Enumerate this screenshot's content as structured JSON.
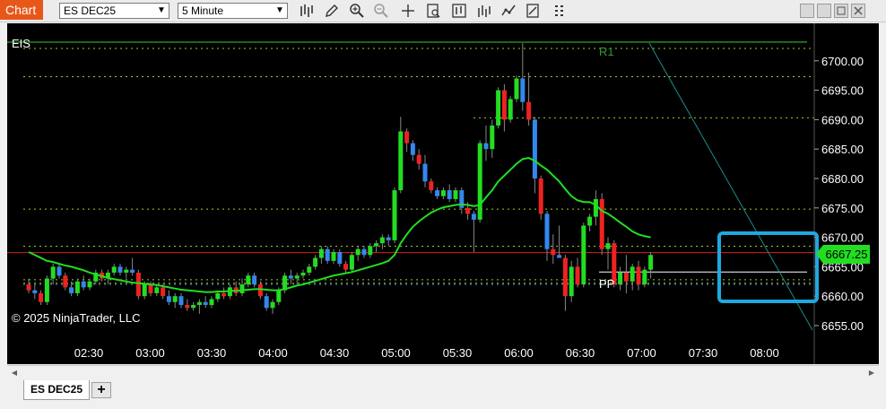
{
  "toolbar": {
    "chart_label": "Chart",
    "instrument": "ES DEC25",
    "interval": "5 Minute"
  },
  "chart": {
    "indicator_label": "EIS",
    "copyright": "© 2025 NinjaTrader, LLC",
    "r1_label": "R1",
    "pp_label": "PP",
    "price_tag": "6667.25"
  },
  "tabs": {
    "active": "ES DEC25",
    "add": "+"
  },
  "chart_data": {
    "type": "candlestick",
    "instrument": "ES DEC25",
    "x_ticks": [
      "02:30",
      "03:00",
      "03:30",
      "04:00",
      "04:30",
      "05:00",
      "05:30",
      "06:00",
      "06:30",
      "07:00",
      "07:30",
      "08:00"
    ],
    "y_ticks": [
      6655.0,
      6660.0,
      6665.0,
      6670.0,
      6675.0,
      6680.0,
      6685.0,
      6690.0,
      6695.0,
      6700.0
    ],
    "ylim": [
      6652.5,
      6703.5
    ],
    "last_price": 6667.25,
    "levels": {
      "r1": 6703.2,
      "pp": 6664.1,
      "red_line": 6667.4
    },
    "series": [
      {
        "name": "candles",
        "ohlc": [
          [
            6662.0,
            6663.0,
            6660.5,
            6661.0
          ],
          [
            6661.0,
            6662.0,
            6659.5,
            6660.5
          ],
          [
            6660.5,
            6661.0,
            6658.5,
            6659.0
          ],
          [
            6659.0,
            6663.5,
            6658.5,
            6663.0
          ],
          [
            6663.0,
            6665.5,
            6662.0,
            6665.0
          ],
          [
            6665.0,
            6665.5,
            6663.0,
            6663.5
          ],
          [
            6663.5,
            6664.0,
            6661.0,
            6661.5
          ],
          [
            6661.5,
            6662.5,
            6660.0,
            6660.5
          ],
          [
            6660.5,
            6663.0,
            6660.0,
            6662.5
          ],
          [
            6662.5,
            6663.5,
            6661.0,
            6661.5
          ],
          [
            6661.5,
            6663.0,
            6661.0,
            6662.5
          ],
          [
            6662.5,
            6664.5,
            6662.0,
            6664.0
          ],
          [
            6664.0,
            6664.5,
            6662.5,
            6663.0
          ],
          [
            6663.0,
            6664.5,
            6662.0,
            6664.0
          ],
          [
            6664.0,
            6665.5,
            6663.5,
            6665.0
          ],
          [
            6665.0,
            6665.5,
            6663.5,
            6664.0
          ],
          [
            6664.0,
            6665.0,
            6663.0,
            6664.5
          ],
          [
            6664.5,
            6666.5,
            6663.5,
            6664.0
          ],
          [
            6664.0,
            6664.5,
            6659.5,
            6660.0
          ],
          [
            6660.0,
            6662.5,
            6659.5,
            6662.0
          ],
          [
            6662.0,
            6662.5,
            6660.0,
            6660.5
          ],
          [
            6660.5,
            6662.0,
            6660.0,
            6661.5
          ],
          [
            6661.5,
            6662.0,
            6659.5,
            6660.0
          ],
          [
            6660.0,
            6661.0,
            6658.5,
            6659.0
          ],
          [
            6659.0,
            6660.5,
            6658.0,
            6660.0
          ],
          [
            6660.0,
            6660.5,
            6658.0,
            6658.5
          ],
          [
            6658.5,
            6659.5,
            6657.5,
            6658.0
          ],
          [
            6658.0,
            6659.0,
            6657.5,
            6658.5
          ],
          [
            6658.5,
            6659.5,
            6657.0,
            6659.0
          ],
          [
            6659.0,
            6660.0,
            6658.0,
            6658.5
          ],
          [
            6658.5,
            6660.0,
            6658.0,
            6659.5
          ],
          [
            6659.5,
            6661.0,
            6659.0,
            6660.5
          ],
          [
            6660.5,
            6661.5,
            6659.5,
            6660.0
          ],
          [
            6660.0,
            6662.0,
            6659.5,
            6661.5
          ],
          [
            6661.5,
            6662.5,
            6660.0,
            6660.5
          ],
          [
            6660.5,
            6663.0,
            6660.0,
            6662.0
          ],
          [
            6662.0,
            6664.0,
            6661.5,
            6663.5
          ],
          [
            6663.5,
            6664.0,
            6661.5,
            6662.0
          ],
          [
            6662.0,
            6662.5,
            6659.5,
            6660.0
          ],
          [
            6660.0,
            6660.5,
            6657.5,
            6658.0
          ],
          [
            6658.0,
            6659.5,
            6657.0,
            6659.0
          ],
          [
            6659.0,
            6661.5,
            6658.5,
            6661.0
          ],
          [
            6661.0,
            6664.0,
            6660.5,
            6663.5
          ],
          [
            6663.5,
            6664.5,
            6662.0,
            6663.0
          ],
          [
            6663.0,
            6664.0,
            6662.0,
            6663.5
          ],
          [
            6663.5,
            6664.5,
            6663.0,
            6664.0
          ],
          [
            6664.0,
            6665.5,
            6663.5,
            6665.0
          ],
          [
            6665.0,
            6667.0,
            6664.5,
            6666.5
          ],
          [
            6666.5,
            6668.5,
            6665.5,
            6668.0
          ],
          [
            6668.0,
            6668.5,
            6665.5,
            6666.0
          ],
          [
            6666.0,
            6668.0,
            6665.5,
            6667.5
          ],
          [
            6667.5,
            6668.0,
            6665.0,
            6665.5
          ],
          [
            6665.5,
            6666.0,
            6664.0,
            6664.5
          ],
          [
            6664.5,
            6667.5,
            6664.0,
            6667.0
          ],
          [
            6667.0,
            6668.5,
            6666.0,
            6668.0
          ],
          [
            6668.0,
            6668.5,
            6666.5,
            6667.0
          ],
          [
            6667.0,
            6669.0,
            6666.5,
            6668.5
          ],
          [
            6668.5,
            6669.5,
            6667.5,
            6669.0
          ],
          [
            6669.0,
            6670.5,
            6668.0,
            6670.0
          ],
          [
            6670.0,
            6670.5,
            6668.5,
            6669.5
          ],
          [
            6669.5,
            6678.5,
            6669.0,
            6678.0
          ],
          [
            6678.0,
            6690.5,
            6677.5,
            6688.0
          ],
          [
            6688.0,
            6688.5,
            6684.5,
            6686.0
          ],
          [
            6686.0,
            6686.5,
            6683.0,
            6684.0
          ],
          [
            6684.0,
            6685.0,
            6681.5,
            6682.5
          ],
          [
            6682.5,
            6684.0,
            6678.5,
            6679.5
          ],
          [
            6679.5,
            6680.0,
            6677.5,
            6678.0
          ],
          [
            6678.0,
            6678.5,
            6676.5,
            6677.0
          ],
          [
            6677.0,
            6678.5,
            6676.5,
            6678.0
          ],
          [
            6678.0,
            6679.0,
            6676.0,
            6676.5
          ],
          [
            6676.5,
            6678.5,
            6676.0,
            6678.0
          ],
          [
            6678.0,
            6678.5,
            6674.0,
            6675.0
          ],
          [
            6675.0,
            6676.0,
            6673.0,
            6674.0
          ],
          [
            6674.0,
            6674.5,
            6667.5,
            6673.0
          ],
          [
            6673.0,
            6686.5,
            6672.5,
            6686.0
          ],
          [
            6686.0,
            6689.0,
            6683.0,
            6685.0
          ],
          [
            6685.0,
            6690.0,
            6683.5,
            6689.0
          ],
          [
            6689.0,
            6695.5,
            6688.5,
            6695.0
          ],
          [
            6695.0,
            6696.0,
            6688.0,
            6690.0
          ],
          [
            6690.0,
            6694.0,
            6689.5,
            6693.5
          ],
          [
            6693.5,
            6697.5,
            6693.0,
            6697.0
          ],
          [
            6697.0,
            6703.0,
            6691.5,
            6693.0
          ],
          [
            6693.0,
            6698.0,
            6689.0,
            6690.0
          ],
          [
            6690.0,
            6690.5,
            6677.5,
            6680.0
          ],
          [
            6680.0,
            6680.5,
            6673.0,
            6674.0
          ],
          [
            6674.0,
            6674.5,
            6666.0,
            6668.0
          ],
          [
            6668.0,
            6670.5,
            6665.5,
            6667.0
          ],
          [
            6667.0,
            6672.0,
            6666.5,
            6666.5
          ],
          [
            6666.5,
            6667.0,
            6657.5,
            6660.0
          ],
          [
            6660.0,
            6666.0,
            6659.0,
            6665.0
          ],
          [
            6665.0,
            6666.5,
            6661.5,
            6662.0
          ],
          [
            6662.0,
            6672.5,
            6661.5,
            6672.0
          ],
          [
            6672.0,
            6674.0,
            6671.0,
            6673.5
          ],
          [
            6673.5,
            6678.0,
            6672.0,
            6676.5
          ],
          [
            6676.5,
            6677.5,
            6667.0,
            6668.0
          ],
          [
            6668.0,
            6670.0,
            6664.5,
            6669.0
          ],
          [
            6669.0,
            6669.5,
            6661.5,
            6662.0
          ],
          [
            6662.0,
            6665.0,
            6661.0,
            6664.0
          ],
          [
            6664.0,
            6667.0,
            6660.5,
            6662.5
          ],
          [
            6662.5,
            6665.5,
            6661.0,
            6665.0
          ],
          [
            6665.0,
            6666.0,
            6661.0,
            6662.0
          ],
          [
            6662.0,
            6665.0,
            6661.5,
            6664.5
          ],
          [
            6664.5,
            6667.5,
            6663.0,
            6667.0
          ]
        ]
      },
      {
        "name": "ema",
        "values": [
          6667.5,
          6667.0,
          6666.5,
          6666.0,
          6665.8,
          6665.5,
          6665.2,
          6665.0,
          6664.7,
          6664.4,
          6664.0,
          6663.7,
          6663.4,
          6663.1,
          6662.9,
          6662.7,
          6662.5,
          6662.3,
          6662.2,
          6662.1,
          6662.0,
          6661.9,
          6661.7,
          6661.5,
          6661.3,
          6661.1,
          6661.0,
          6660.9,
          6660.8,
          6660.7,
          6660.7,
          6660.8,
          6660.8,
          6660.9,
          6660.9,
          6661.0,
          6661.1,
          6661.2,
          6661.2,
          6661.1,
          6661.0,
          6661.0,
          6661.2,
          6661.5,
          6661.8,
          6662.0,
          6662.3,
          6662.6,
          6662.9,
          6663.2,
          6663.5,
          6663.7,
          6663.9,
          6664.1,
          6664.4,
          6664.7,
          6665.0,
          6665.3,
          6665.6,
          6666.0,
          6667.0,
          6669.0,
          6670.5,
          6671.8,
          6672.7,
          6673.5,
          6674.2,
          6674.7,
          6675.1,
          6675.3,
          6675.5,
          6675.6,
          6675.5,
          6675.3,
          6675.5,
          6676.8,
          6678.0,
          6679.5,
          6680.5,
          6681.5,
          6682.5,
          6683.3,
          6683.5,
          6683.0,
          6682.2,
          6681.5,
          6680.5,
          6679.5,
          6678.2,
          6677.0,
          6676.3,
          6676.0,
          6676.0,
          6675.5,
          6674.5,
          6674.0,
          6673.3,
          6672.5,
          6671.8,
          6671.0,
          6670.5,
          6670.2,
          6670.0
        ]
      }
    ]
  }
}
